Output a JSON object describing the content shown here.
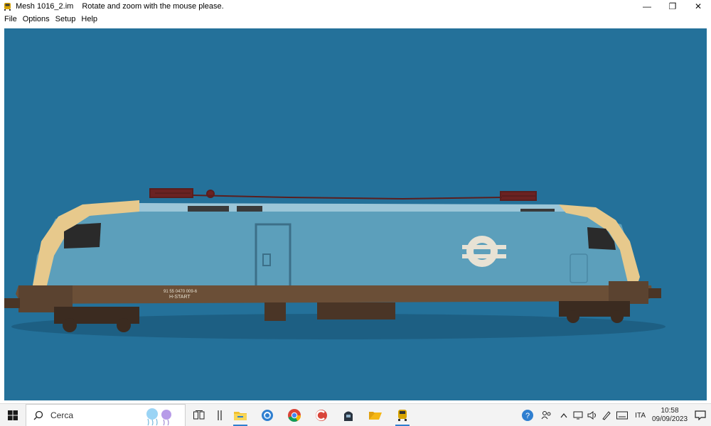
{
  "window": {
    "title": "Mesh 1016_2.im",
    "message": "Rotate and zoom with the mouse please.",
    "controls": {
      "minimize": "—",
      "restore": "❐",
      "close": "✕"
    }
  },
  "menu": {
    "items": [
      {
        "label": "File"
      },
      {
        "label": "Options"
      },
      {
        "label": "Setup"
      },
      {
        "label": "Help"
      }
    ]
  },
  "viewport": {
    "background": "#24719a",
    "model": {
      "number_text": "91 55 0470 009-6",
      "name_text": "H-START",
      "body_color": "#5c9fbb",
      "roof_color": "#9cc6d8",
      "cab_color": "#e7c98c",
      "frame_color": "#6b4f37"
    }
  },
  "taskbar": {
    "search_placeholder": "Cerca",
    "apps": [
      {
        "name": "task-view-icon"
      },
      {
        "name": "widgets-icon"
      },
      {
        "name": "file-explorer-icon"
      },
      {
        "name": "sync-app-icon"
      },
      {
        "name": "chrome-icon"
      },
      {
        "name": "ccleaner-icon"
      },
      {
        "name": "train-app-icon"
      },
      {
        "name": "folder-app-icon"
      },
      {
        "name": "mesh-viewer-icon",
        "active": true
      }
    ],
    "tray": {
      "language": "ITA",
      "time": "10:58",
      "date": "09/09/2023"
    }
  }
}
